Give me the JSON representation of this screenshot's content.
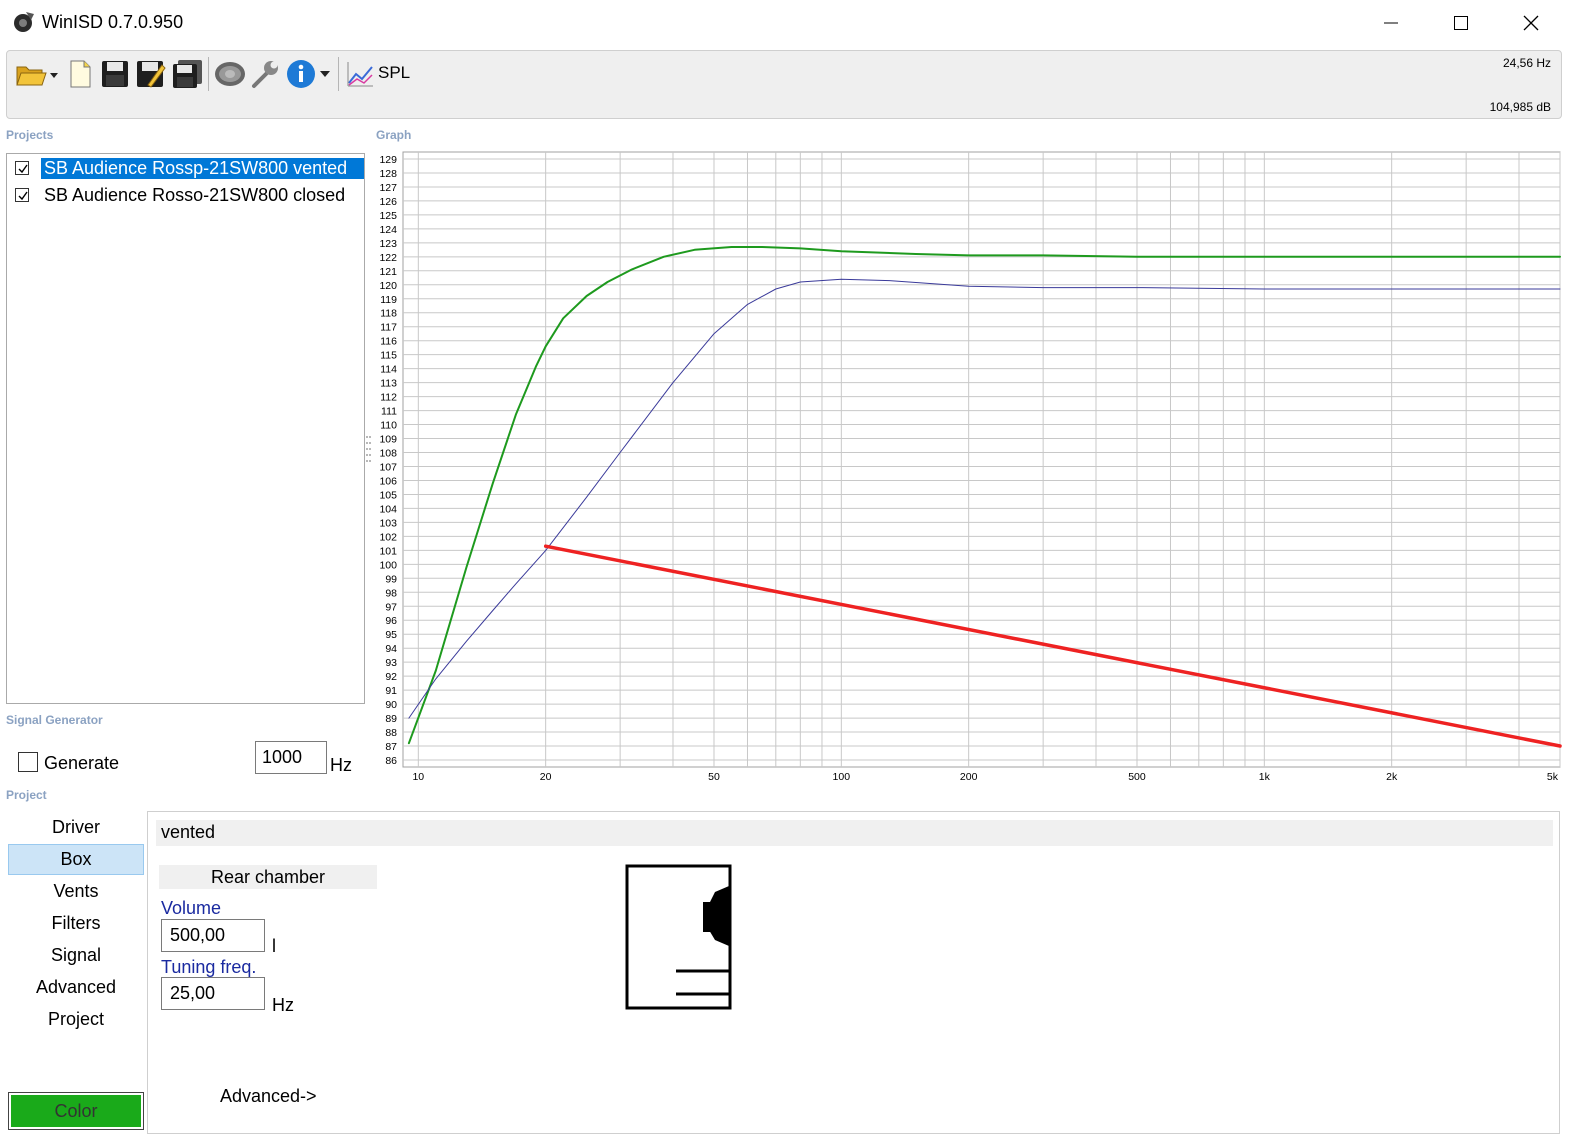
{
  "window": {
    "title": "WinISD 0.7.0.950"
  },
  "toolbar": {
    "spl_label": "SPL",
    "readout_freq": "24,56 Hz",
    "readout_db": "104,985 dB"
  },
  "sections": {
    "projects": "Projects",
    "graph": "Graph",
    "signal_generator": "Signal Generator",
    "project": "Project"
  },
  "projects": [
    {
      "name": "SB Audience Rossp-21SW800 vented",
      "checked": true,
      "selected": true
    },
    {
      "name": "SB Audience Rosso-21SW800 closed",
      "checked": true,
      "selected": false
    }
  ],
  "signal_generator": {
    "generate_label": "Generate",
    "frequency": "1000",
    "unit": "Hz"
  },
  "nav": [
    "Driver",
    "Box",
    "Vents",
    "Filters",
    "Signal",
    "Advanced",
    "Project"
  ],
  "nav_active": "Box",
  "color_button": {
    "label": "Color",
    "color": "#1aaa1a"
  },
  "project_panel": {
    "project_name": "vented",
    "chamber_header": "Rear chamber",
    "volume_label": "Volume",
    "volume_value": "500,00",
    "volume_unit": "l",
    "tuning_label": "Tuning freq.",
    "tuning_value": "25,00",
    "tuning_unit": "Hz",
    "advanced_link": "Advanced->"
  },
  "chart_data": {
    "type": "line",
    "title": "",
    "xlabel": "",
    "ylabel": "",
    "xscale": "log",
    "xlim": [
      9.2,
      5000
    ],
    "ylim": [
      85.5,
      129.5
    ],
    "x_tick_labels": [
      {
        "value": 10,
        "label": "10"
      },
      {
        "value": 20,
        "label": "20"
      },
      {
        "value": 50,
        "label": "50"
      },
      {
        "value": 100,
        "label": "100"
      },
      {
        "value": 200,
        "label": "200"
      },
      {
        "value": 500,
        "label": "500"
      },
      {
        "value": 1000,
        "label": "1k"
      },
      {
        "value": 2000,
        "label": "2k"
      },
      {
        "value": 5000,
        "label": "5k"
      }
    ],
    "y_ticks": [
      86,
      87,
      88,
      89,
      90,
      91,
      92,
      93,
      94,
      95,
      96,
      97,
      98,
      99,
      100,
      101,
      102,
      103,
      104,
      105,
      106,
      107,
      108,
      109,
      110,
      111,
      112,
      113,
      114,
      115,
      116,
      117,
      118,
      119,
      120,
      121,
      122,
      123,
      124,
      125,
      126,
      127,
      128,
      129
    ],
    "grid": true,
    "series": [
      {
        "color": "#1e9a1e",
        "x": [
          9.5,
          11,
          13,
          15,
          17,
          19,
          20,
          22,
          25,
          28,
          32,
          38,
          45,
          55,
          65,
          80,
          100,
          150,
          200,
          300,
          500,
          1000,
          2000,
          5000
        ],
        "y": [
          87.2,
          92.4,
          99.8,
          105.8,
          110.7,
          114.2,
          115.6,
          117.6,
          119.2,
          120.2,
          121.1,
          122.0,
          122.5,
          122.7,
          122.7,
          122.6,
          122.4,
          122.2,
          122.1,
          122.1,
          122.0,
          122.0,
          122.0,
          122.0
        ]
      },
      {
        "color": "#3a3a9a",
        "x": [
          9.5,
          11,
          13,
          15,
          17,
          20,
          25,
          30,
          40,
          50,
          60,
          70,
          80,
          100,
          130,
          200,
          300,
          500,
          1000,
          2000,
          5000
        ],
        "y": [
          89.0,
          91.8,
          94.5,
          96.7,
          98.6,
          101.0,
          104.8,
          108.0,
          113.0,
          116.5,
          118.6,
          119.7,
          120.2,
          120.4,
          120.3,
          119.9,
          119.8,
          119.8,
          119.7,
          119.7,
          119.7
        ]
      },
      {
        "color": "#ee2222",
        "x": [
          20,
          5000
        ],
        "y": [
          101.3,
          87.0
        ]
      }
    ]
  }
}
